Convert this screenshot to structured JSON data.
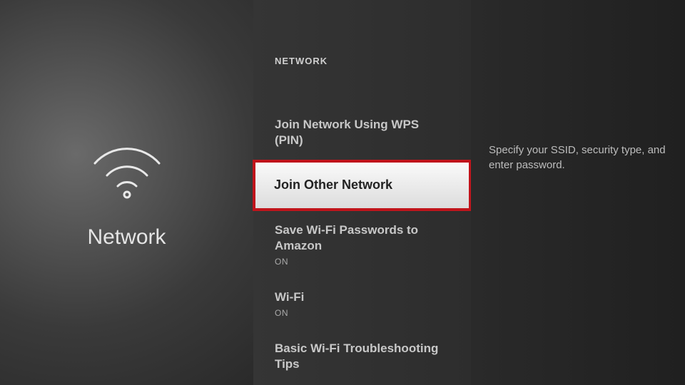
{
  "leftPanel": {
    "title": "Network"
  },
  "section": {
    "header": "NETWORK"
  },
  "menu": {
    "item0": {
      "title": "Join Network Using WPS (PIN)"
    },
    "item1": {
      "title": "Join Other Network"
    },
    "item2": {
      "title": "Save Wi-Fi Passwords to Amazon",
      "sub": "ON"
    },
    "item3": {
      "title": "Wi-Fi",
      "sub": "ON"
    },
    "item4": {
      "title": "Basic Wi-Fi Troubleshooting Tips"
    }
  },
  "detail": {
    "description": "Specify your SSID, security type, and enter password."
  }
}
